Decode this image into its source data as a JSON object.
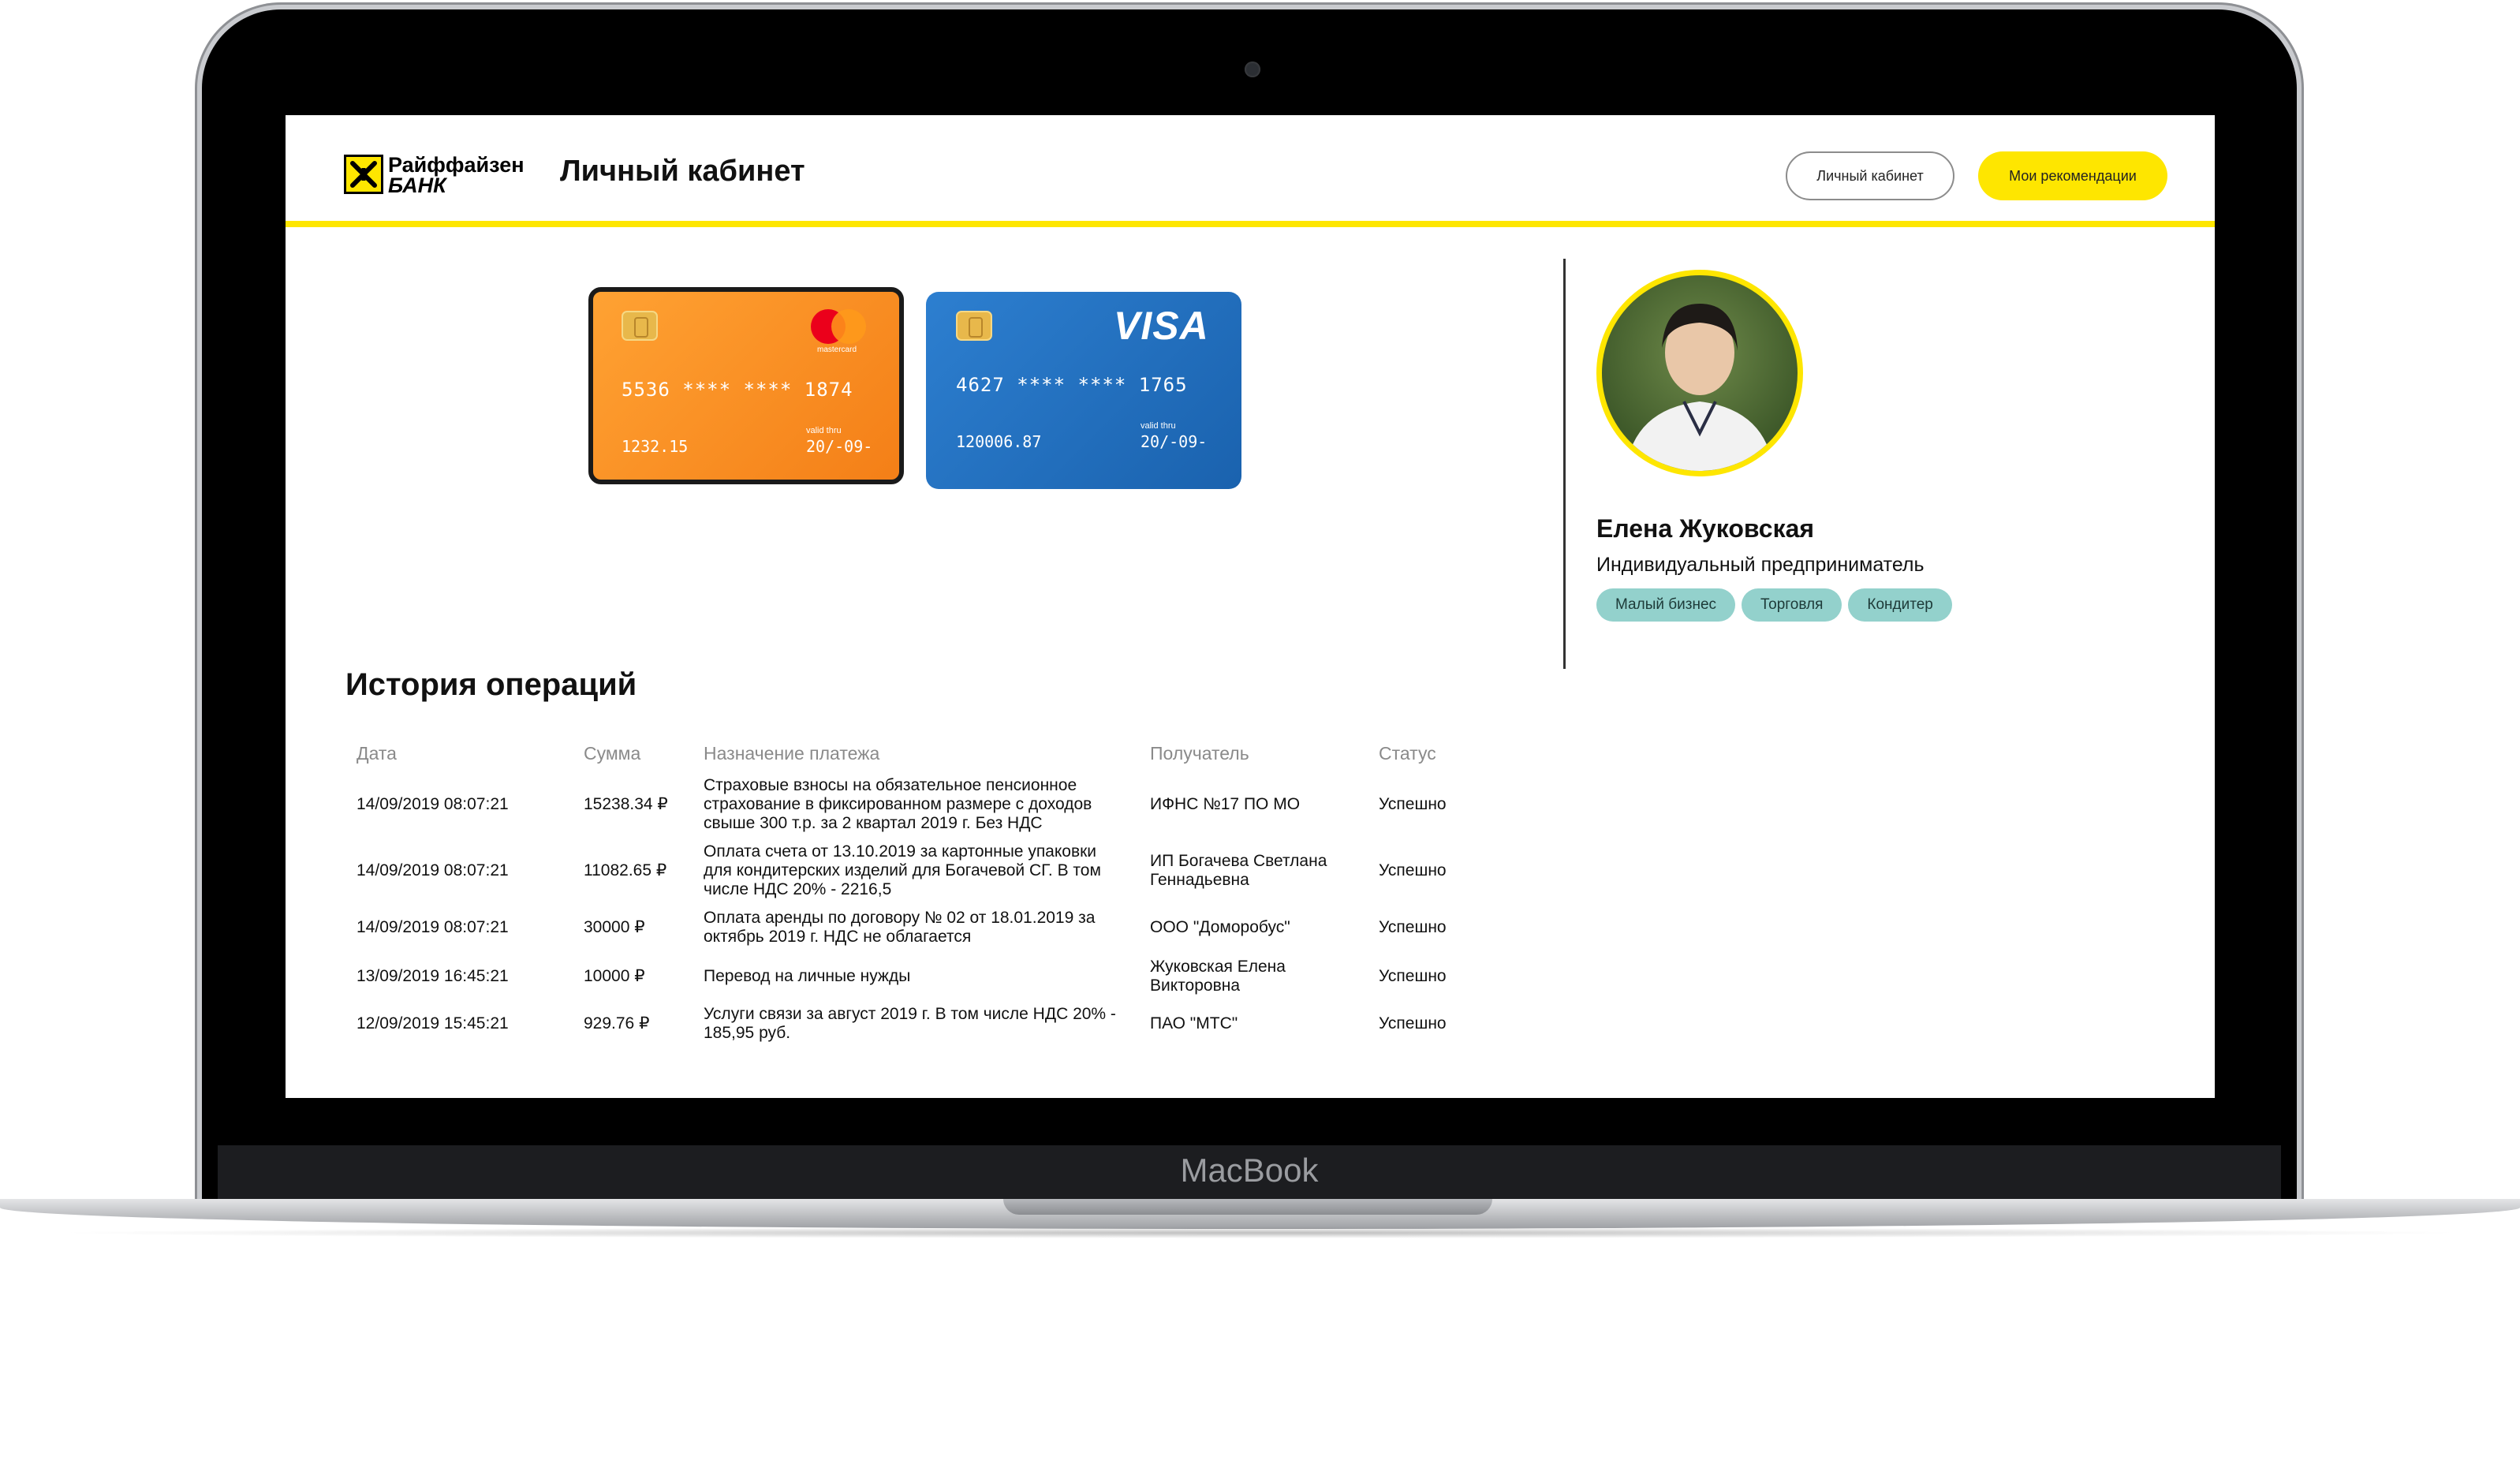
{
  "device": {
    "label": "MacBook"
  },
  "header": {
    "logo_line1": "Райффайзен",
    "logo_line2": "БАНК",
    "title": "Личный кабинет",
    "btn_cabinet": "Личный кабинет",
    "btn_recommendations": "Мои рекомендации",
    "accent_color": "#fee600"
  },
  "cards": [
    {
      "number": "5536 **** **** 1874",
      "balance": "1232.15",
      "valid_label": "valid thru",
      "date": "20/-09-",
      "brand": "mastercard",
      "brand_text": "mastercard",
      "color": "#f58a1f"
    },
    {
      "number": "4627 **** **** 1765",
      "balance": "120006.87",
      "valid_label": "valid thru",
      "date": "20/-09-",
      "brand": "visa",
      "brand_text": "VISA",
      "color": "#1f6fc0"
    }
  ],
  "profile": {
    "name": "Елена Жуковская",
    "role": "Индивидуальный предприниматель",
    "tags": [
      "Малый бизнес",
      "Торговля",
      "Кондитер"
    ],
    "tag_color": "#93d1cc"
  },
  "history": {
    "title": "История операций",
    "columns": [
      "Дата",
      "Сумма",
      "Назначение платежа",
      "Получатель",
      "Статус"
    ],
    "rows": [
      {
        "date": "14/09/2019 08:07:21",
        "amount": "15238.34 ₽",
        "purpose": [
          "Страховые взносы на обязательное пенсионное",
          "страхование в фиксированном размере с доходов",
          "свыше 300 т.р. за 2 квартал 2019 г. Без НДС"
        ],
        "recipient": [
          "ИФНС №17 ПО МО"
        ],
        "status": "Успешно"
      },
      {
        "date": "14/09/2019 08:07:21",
        "amount": "11082.65 ₽",
        "purpose": [
          "Оплата счета от 13.10.2019 за картонные упаковки",
          "для кондитерских изделий для Богачевой СГ. В том",
          "числе НДС 20% - 2216,5"
        ],
        "recipient": [
          "ИП Богачева Светлана",
          "Геннадьевна"
        ],
        "status": "Успешно"
      },
      {
        "date": "14/09/2019 08:07:21",
        "amount": "30000 ₽",
        "purpose": [
          "Оплата аренды по договору № 02 от 18.01.2019 за",
          "октябрь 2019 г. НДС не облагается"
        ],
        "recipient": [
          "ООО \"Доморобус\""
        ],
        "status": "Успешно"
      },
      {
        "date": "13/09/2019 16:45:21",
        "amount": "10000 ₽",
        "purpose": [
          "Перевод на личные нужды"
        ],
        "recipient": [
          "Жуковская Елена",
          "Викторовна"
        ],
        "status": "Успешно"
      },
      {
        "date": "12/09/2019 15:45:21",
        "amount": "929.76 ₽",
        "purpose": [
          "Услуги связи за август 2019 г. В том числе НДС 20% -",
          "185,95 руб."
        ],
        "recipient": [
          "ПАО \"МТС\""
        ],
        "status": "Успешно"
      }
    ]
  }
}
